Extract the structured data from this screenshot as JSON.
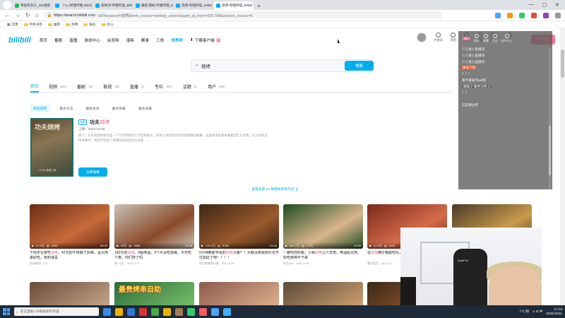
{
  "browser": {
    "tabs": [
      {
        "label": "幸福有多久_360搜索",
        "color": "#1abc5c",
        "active": false
      },
      {
        "label": "（\"ω·)哔哩哔哩 bilibili",
        "color": "#00aeec",
        "active": false
      },
      {
        "label": "袁钟津-哔哩哔哩_Bilibili",
        "color": "#00aeec",
        "active": false
      },
      {
        "label": "摄影/漏刷-哔哩哔哩_Bilibili",
        "color": "#00aeec",
        "active": false
      },
      {
        "label": "烧烤-哔哩哔哩_Bilibili",
        "color": "#00aeec",
        "active": false
      },
      {
        "label": "烧烤-哔哩哔哩_Bilibili",
        "color": "#00aeec",
        "active": true
      }
    ],
    "new_tab": "+",
    "window_controls": [
      "—",
      "▢",
      "✕"
    ],
    "url_host": "https://search.bilibili.com",
    "url_rest": "/all?keyword=烧烤&from_source=webtop_search&spm_id_from=333.788&search_source=5",
    "bookmarks": [
      "应用",
      "手机书签",
      "推荐",
      "购物",
      "娱乐",
      "办公"
    ]
  },
  "bili": {
    "logo": "bilibili",
    "nav": [
      "首页",
      "番剧",
      "直播",
      "游戏中心",
      "会员购",
      "漫画",
      "赛事",
      "三体"
    ],
    "nav_highlight": "世界杯",
    "download": "下载客户端",
    "download_badge": "新",
    "right_icons": [
      "大会员",
      "消息",
      "动态",
      "收藏",
      "历史",
      "创作中心"
    ],
    "message_badge": "99+",
    "upload": "投稿",
    "search_query": "烧烤",
    "search_button": "搜索",
    "result_tabs": [
      {
        "label": "综合",
        "count": ""
      },
      {
        "label": "视频",
        "count": "99+"
      },
      {
        "label": "番剧",
        "count": "18"
      },
      {
        "label": "影视",
        "count": "29"
      },
      {
        "label": "直播",
        "count": "8"
      },
      {
        "label": "专栏",
        "count": "99+"
      },
      {
        "label": "话题",
        "count": "0"
      },
      {
        "label": "用户",
        "count": "99+"
      }
    ],
    "sorts": [
      "综合排序",
      "最多点击",
      "最新发布",
      "最多弹幕",
      "最多收藏"
    ],
    "featured": {
      "tag": "电影",
      "title_prefix": "功夫",
      "title_highlight": "烧烤",
      "date": "上映：2022-10-26",
      "desc": "简介：功夫烧烤讲述的是一个在外求索的儿子回到家乡，接手父亲经营多年的烧烤摊的故事。这里每串肉都承载着记忆与亲情，在父亲的言传身教中，他终于明白了烧烤背后的坚持与温度……",
      "cover_title": "功夫烧烤",
      "cover_sub": "10.26 温情上映",
      "button": "立即观看"
    },
    "see_all": "查看全部 20 部相关影视作品 ❯",
    "videos": [
      {
        "title_a": "下周天在家吃",
        "hi": "烧烤",
        "title_b": "，42元的牛肉做了30串，是大肉串好吃，有料惊喜",
        "up": "吃肉的你 · 5-6",
        "views": "47.3万",
        "danmaku": "1302",
        "dur": "06:03",
        "c1": "#6a2d17",
        "c2": "#c76a3a"
      },
      {
        "title_a": "150元的",
        "hi": "烧烤",
        "title_b": "，6瓶啤酒，3个月没吃烧烤，今天吃个爽，你们馋了吗",
        "up": "多一点L · 2020-4-11",
        "views": "30万",
        "danmaku": "2368",
        "dur": "07:36",
        "c1": "#c9c1b5",
        "c2": "#8a4a2a"
      },
      {
        "title_a": "5分钟教能学会的",
        "hi": "烧烤",
        "title_b": "大餐？！大概深夜就快乐也不过如此了吧！！！！",
        "up": "努力的美食小猿 · 2021-8-15",
        "views": "175.4万",
        "danmaku": "3736",
        "dur": "01:36",
        "c1": "#3d2616",
        "c2": "#9a5a2c"
      },
      {
        "title_a": "一路吃四份顿，小我",
        "hi": "烧烤",
        "title_b": "三斤羊肉，啤酒配大肉，好吃到停不下来",
        "up": "徐大sao · 2020-2-26",
        "views": "342.1万",
        "danmaku": "1.4万",
        "dur": "12:08",
        "c1": "#1f4a22",
        "c2": "#d9b58c"
      },
      {
        "title_a": "这",
        "hi": "烧烤",
        "title_b": "摊价格能吃吗，原价120元，现在只要28？",
        "up": "重庆吃货 · 2021-5-2",
        "views": "47.9万",
        "danmaku": "2141",
        "dur": "03:08",
        "c1": "#7a2a1a",
        "c2": "#d46a4a"
      },
      {
        "title_a": "晚上带回家的",
        "hi": "烧烤",
        "title_b": "摊价格能吃吗，原价120元，现在只要28？",
        "up": "重庆吃货 · 2021-5-2",
        "views": "28.1万",
        "danmaku": "1022",
        "dur": "05:40",
        "c1": "#4a3a2a",
        "c2": "#c99a4a"
      }
    ],
    "row2": [
      {
        "label": "",
        "c1": "#6a4a3a",
        "c2": "#c8a68a"
      },
      {
        "label": "最贵烤串自助",
        "c1": "#2a6a3a",
        "c2": "#7ac06a"
      },
      {
        "label": "",
        "c1": "#8a5a4a",
        "c2": "#e0b090"
      },
      {
        "label": "",
        "c1": "#5a4a3a",
        "c2": "#d0a070"
      },
      {
        "label": "",
        "c1": "#3a2a1a",
        "c2": "#a05a2a"
      }
    ]
  },
  "chat": {
    "header_icons": [
      "消息",
      "收藏",
      "历史",
      "创作中心"
    ],
    "badge": "99+",
    "lines": [
      {
        "n": "欢迎",
        "t": "进入直播间",
        "style": ""
      },
      {
        "n": "欢迎",
        "t": "进入直播间",
        "style": ""
      },
      {
        "n": "欢迎",
        "t": "进入直播间",
        "style": ""
      },
      {
        "n": "",
        "t": "关注了你",
        "style": "hl"
      },
      {
        "n": "",
        "t": "？？？",
        "style": ""
      },
      {
        "n": "",
        "t": "要不要来学pdf吧",
        "style": ""
      },
      {
        "n": "",
        "t": "那就了  要学习色 ∨",
        "style": "pill"
      },
      {
        "n": "",
        "t": "？？",
        "style": ""
      },
      {
        "n": "",
        "t": "",
        "style": ""
      },
      {
        "n": "",
        "t": "这是哪边吧",
        "style": ""
      },
      {
        "n": "",
        "t": "",
        "style": "hlo"
      },
      {
        "n": "",
        "t": "",
        "style": "hlo"
      },
      {
        "n": "",
        "t": "",
        "style": "hlo"
      },
      {
        "n": "",
        "t": "",
        "style": "hlo"
      },
      {
        "n": "",
        "t": "",
        "style": "hlo"
      },
      {
        "n": "",
        "t": "",
        "style": ""
      },
      {
        "n": "",
        "t": "",
        "style": ""
      }
    ]
  },
  "webcam": {
    "chair_label": "AutoFull"
  },
  "taskbar": {
    "search_placeholder": "在这里输入你要搜索的内容",
    "apps": [
      "#3a8ee6",
      "#f0b400",
      "#2a7ad5",
      "#d33",
      "#4a4",
      "#f0b400",
      "#a67c52",
      "#2ecc71",
      "#ff5a5a",
      "#4aa3ff",
      "#3bb0ff"
    ],
    "weather": "7°C 阴",
    "time": "17:16",
    "date": "2022/12/11",
    "tray_icons": "∧ ⊡ 中"
  }
}
